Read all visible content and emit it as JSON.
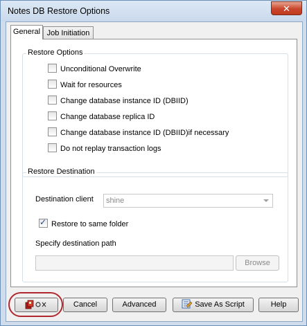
{
  "window": {
    "title": "Notes DB Restore Options",
    "close_glyph": "✕"
  },
  "tabs": [
    {
      "label": "General",
      "active": true
    },
    {
      "label": "Job Initiation",
      "active": false
    }
  ],
  "restore_options": {
    "title": "Restore Options",
    "items": [
      {
        "label": "Unconditional Overwrite",
        "checked": false
      },
      {
        "label": "Wait for resources",
        "checked": false
      },
      {
        "label": "Change database instance ID (DBIID)",
        "checked": false
      },
      {
        "label": "Change database replica ID",
        "checked": false
      },
      {
        "label": "Change database instance ID (DBIID)if necessary",
        "checked": false
      },
      {
        "label": "Do not replay transaction logs",
        "checked": false
      }
    ]
  },
  "restore_destination": {
    "title": "Restore Destination",
    "client_label": "Destination client",
    "client_value": "shine",
    "same_folder_label": "Restore to same folder",
    "same_folder_checked": true,
    "path_label": "Specify destination path",
    "path_value": "",
    "browse_label": "Browse"
  },
  "buttons": {
    "ok_icon": "ok-icon",
    "cancel": "Cancel",
    "advanced": "Advanced",
    "save_script": "Save As Script",
    "help": "Help"
  },
  "colors": {
    "accent": "#1c4b8c",
    "highlight": "#b0282d"
  }
}
